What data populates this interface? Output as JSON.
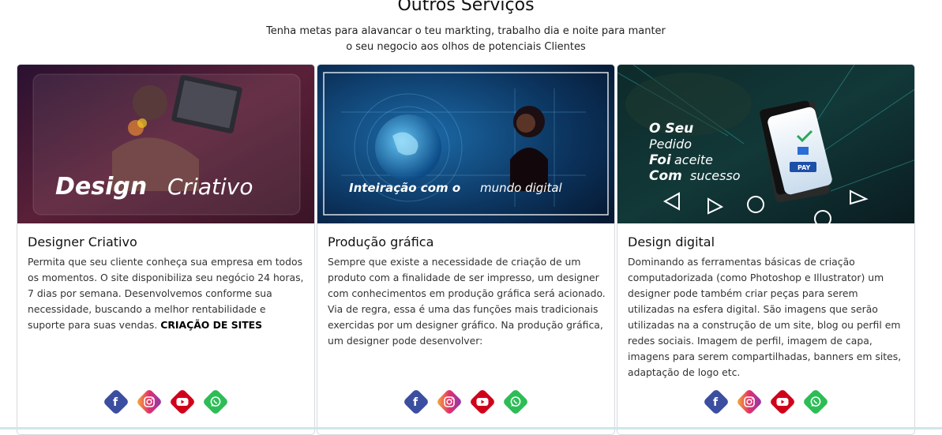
{
  "section": {
    "title": "Outros Serviços",
    "subtitle_line1": "Tenha metas para alavancar o teu markting, trabalho dia e noite para manter",
    "subtitle_line2": "o seu negocio aos olhos de potenciais Clientes"
  },
  "cards": [
    {
      "image_caption_bold": "Design",
      "image_caption_light": "Criativo",
      "title": "Designer Criativo",
      "text": "Permita que seu cliente conheça sua empresa em todos os momentos. O site disponibiliza seu negócio 24 horas, 7 dias por semana. Desenvolvemos conforme sua necessidade, buscando a melhor rentabilidade e suporte para suas vendas.",
      "text_bold": "CRIAÇÃO DE SITES"
    },
    {
      "image_caption_bold": "Inteiração com o",
      "image_caption_light": "mundo digital",
      "title": "Produção gráfica",
      "text": "Sempre que existe a necessidade de criação de um produto com a finalidade de ser impresso, um designer com conhecimentos em produção gráfica será acionado. Via de regra, essa é uma das funções mais tradicionais exercidas por um designer gráfico. Na produção gráfica, um designer pode desenvolver:"
    },
    {
      "image_line1_bold": "O Seu",
      "image_line2": "Pedido",
      "image_line3_bold": "Foi",
      "image_line3_light": "aceite",
      "image_line4_bold": "Com",
      "image_line4_light": "sucesso",
      "image_pay_label": "PAY",
      "title": "Design digital",
      "text": "Dominando as ferramentas básicas de criação computadorizada (como Photoshop e Illustrator) um designer pode também criar peças para serem utilizadas na esfera digital. São imagens que serão utilizadas na a construção de um site, blog ou perfil em redes sociais. Imagem de perfil, imagem de capa, imagens para serem compartilhadas, banners em sites, adaptação de logo etc."
    }
  ],
  "social_icons": [
    "facebook-icon",
    "instagram-icon",
    "youtube-icon",
    "whatsapp-icon"
  ],
  "social_labels": {
    "facebook": "f"
  },
  "colors": {
    "facebook": "#3b4ea0",
    "instagram": "#e1306c",
    "youtube": "#d0021b",
    "whatsapp": "#2dbd56"
  }
}
